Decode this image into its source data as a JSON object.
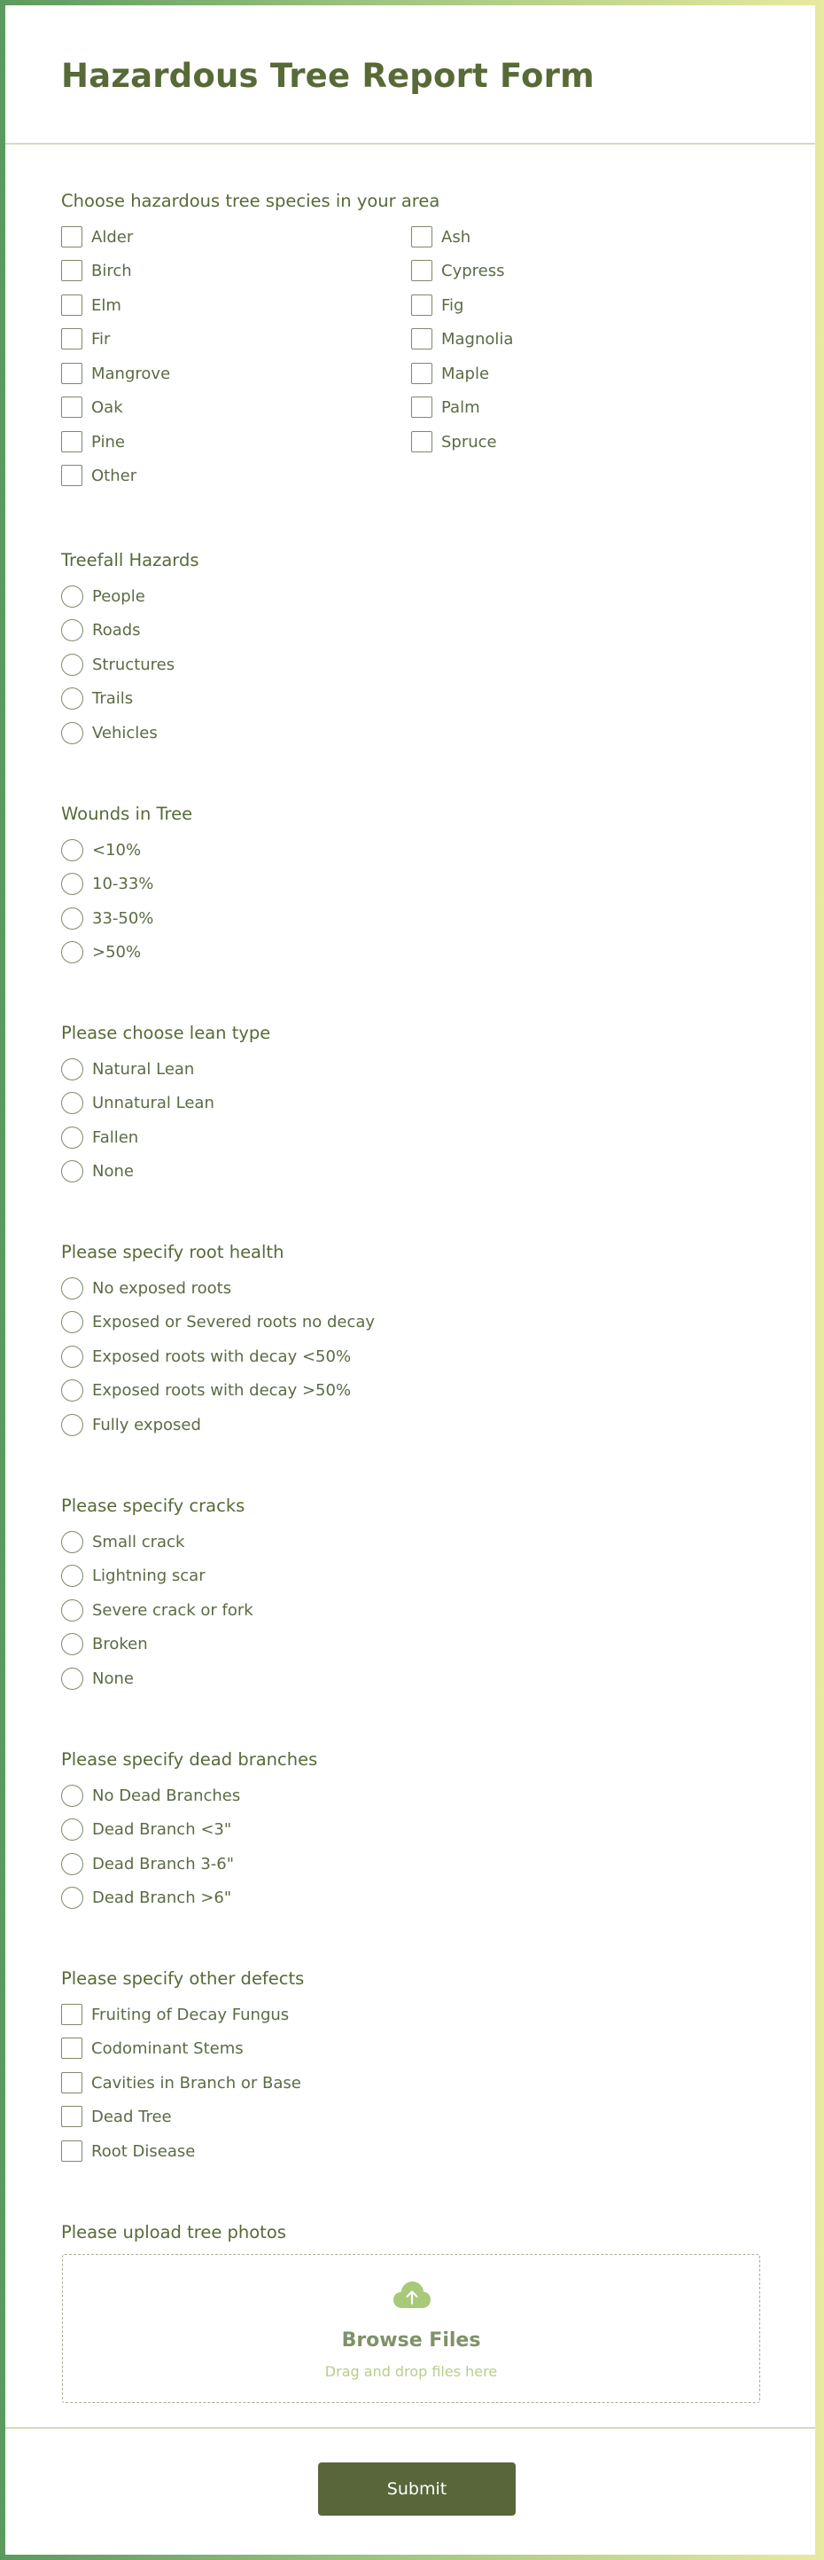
{
  "form": {
    "title": "Hazardous Tree Report Form",
    "submit_label": "Submit"
  },
  "species": {
    "title": "Choose hazardous tree species in your area",
    "options": [
      "Alder",
      "Ash",
      "Birch",
      "Cypress",
      "Elm",
      "Fig",
      "Fir",
      "Magnolia",
      "Mangrove",
      "Maple",
      "Oak",
      "Palm",
      "Pine",
      "Spruce",
      "Other"
    ]
  },
  "treefall": {
    "title": "Treefall Hazards",
    "options": [
      "People",
      "Roads",
      "Structures",
      "Trails",
      "Vehicles"
    ]
  },
  "wounds": {
    "title": "Wounds in Tree",
    "options": [
      "<10%",
      "10-33%",
      "33-50%",
      ">50%"
    ]
  },
  "lean": {
    "title": "Please choose lean type",
    "options": [
      "Natural Lean",
      "Unnatural Lean",
      "Fallen",
      "None"
    ]
  },
  "roots": {
    "title": "Please specify root health",
    "options": [
      "No exposed roots",
      "Exposed or Severed roots no decay",
      "Exposed roots with decay <50%",
      "Exposed roots with decay >50%",
      "Fully exposed"
    ]
  },
  "cracks": {
    "title": "Please specify cracks",
    "options": [
      "Small crack",
      "Lightning scar",
      "Severe crack or fork",
      "Broken",
      "None"
    ]
  },
  "branches": {
    "title": "Please specify dead branches",
    "options": [
      "No Dead Branches",
      "Dead Branch <3\"",
      "Dead Branch 3-6\"",
      "Dead Branch >6\""
    ]
  },
  "defects": {
    "title": "Please specify other defects",
    "options": [
      "Fruiting of Decay Fungus",
      "Codominant Stems",
      "Cavities in Branch or Base",
      "Dead Tree",
      "Root Disease"
    ]
  },
  "upload": {
    "title": "Please upload tree photos",
    "browse_label": "Browse Files",
    "drag_text": "Drag and drop files here",
    "icon": "cloud-upload-icon"
  }
}
